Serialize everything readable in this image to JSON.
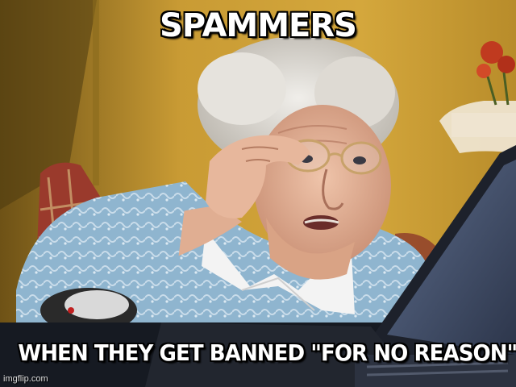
{
  "meme": {
    "top_caption": "SPAMMERS",
    "bottom_caption": "WHEN THEY GET BANNED \"FOR NO REASON\"",
    "watermark": "imgflip.com"
  },
  "colors": {
    "wall": "#c89a33",
    "wall_shadow": "#8a6a1c",
    "hair": "#d9d6d0",
    "skin": "#e3b59c",
    "sweater": "#8eb6d0",
    "collar": "#f2f2f2",
    "laptop": "#1b1f2a",
    "screen": "#4a5a7a",
    "caption_fill": "#ffffff",
    "caption_outline": "#000000"
  }
}
